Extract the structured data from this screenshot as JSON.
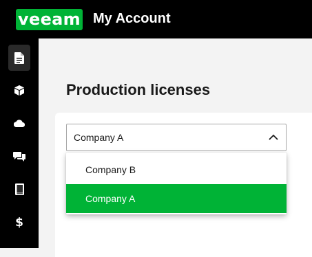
{
  "header": {
    "logo_text": "veeam",
    "app_title": "My Account"
  },
  "sidebar": {
    "items": [
      {
        "icon": "document-icon",
        "active": true
      },
      {
        "icon": "cube-icon",
        "active": false
      },
      {
        "icon": "cloud-icon",
        "active": false
      },
      {
        "icon": "chat-icon",
        "active": false
      },
      {
        "icon": "book-icon",
        "active": false
      },
      {
        "icon": "dollar-icon",
        "active": false
      }
    ]
  },
  "main": {
    "title": "Production licenses",
    "company_select": {
      "value": "Company A",
      "expanded": true,
      "options": [
        {
          "label": "Company B",
          "selected": false
        },
        {
          "label": "Company A",
          "selected": true
        }
      ]
    }
  },
  "colors": {
    "brand": "#00b336",
    "topbar": "#000000",
    "background": "#f3f3f3"
  }
}
